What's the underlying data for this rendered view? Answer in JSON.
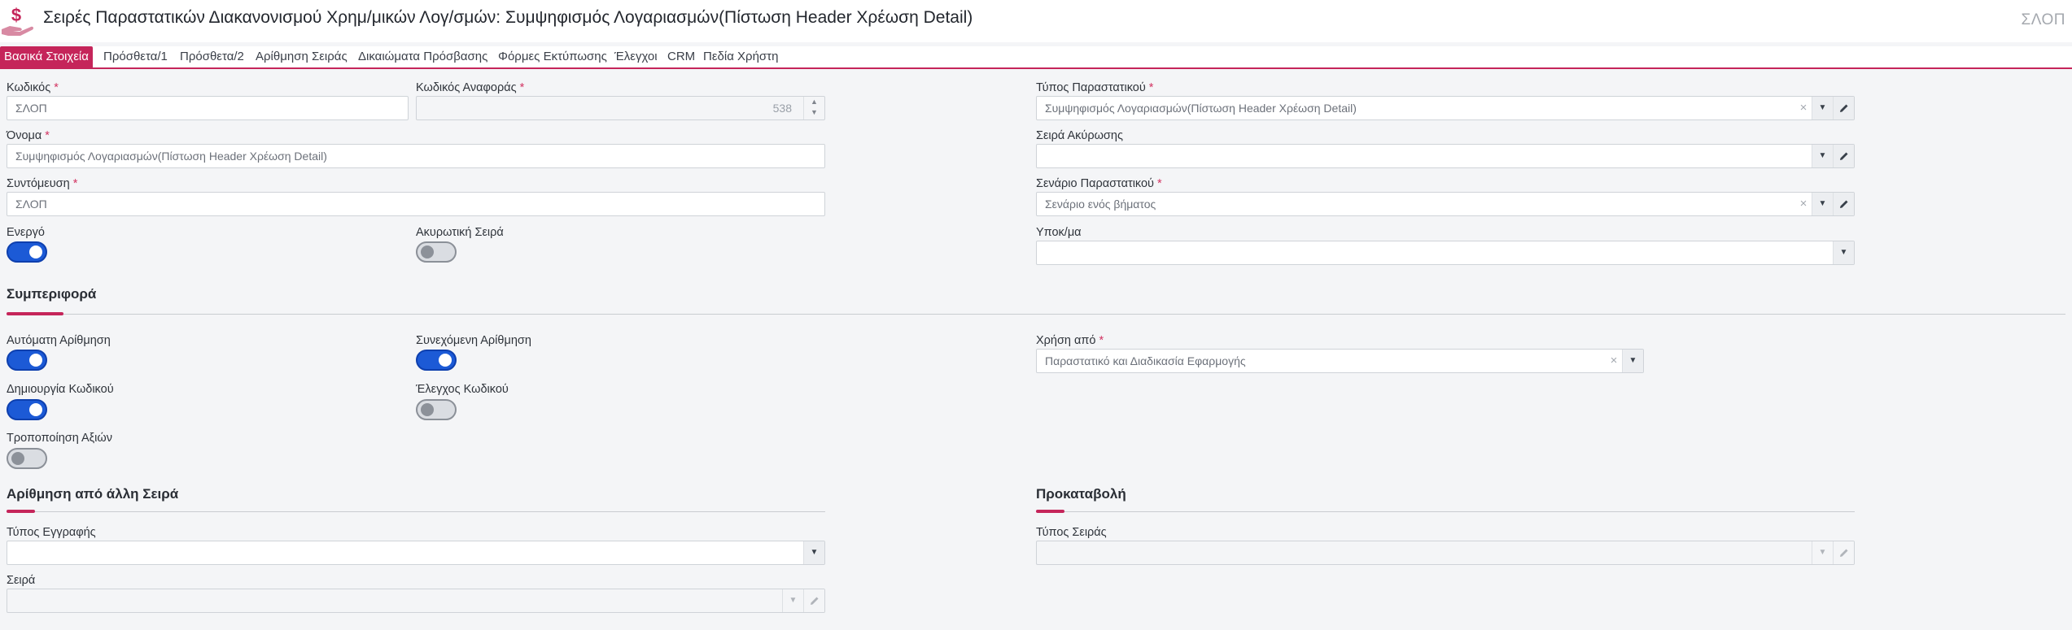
{
  "header": {
    "title": "Σειρές Παραστατικών Διακανονισμού Χρημ/μικών Λογ/σμών: Συμψηφισμός Λογαριασμών(Πίστωση Header Χρέωση Detail)",
    "code": "ΣΛΟΠ",
    "logo_icon": "hand-dollar-icon",
    "accent_color": "#c5255a"
  },
  "tabs": [
    {
      "label": "Βασικά Στοιχεία",
      "active": true
    },
    {
      "label": "Πρόσθετα/1"
    },
    {
      "label": "Πρόσθετα/2"
    },
    {
      "label": "Αρίθμηση Σειράς"
    },
    {
      "label": "Δικαιώματα Πρόσβασης"
    },
    {
      "label": "Φόρμες Εκτύπωσης"
    },
    {
      "label": "Έλεγχοι"
    },
    {
      "label": "CRM"
    },
    {
      "label": "Πεδία Χρήστη"
    }
  ],
  "fields": {
    "kodikos": {
      "label": "Κωδικός",
      "required": "*",
      "value": "ΣΛΟΠ"
    },
    "kodikos_anaforas": {
      "label": "Κωδικός Αναφοράς",
      "required": "*",
      "value": "538"
    },
    "typos_parastatikou": {
      "label": "Τύπος Παραστατικού",
      "required": "*",
      "value": "Συμψηφισμός Λογαριασμών(Πίστωση Header Χρέωση Detail)"
    },
    "onoma": {
      "label": "Όνομα",
      "required": "*",
      "value": "Συμψηφισμός Λογαριασμών(Πίστωση Header Χρέωση Detail)"
    },
    "seira_akyrosis": {
      "label": "Σειρά Ακύρωσης",
      "value": ""
    },
    "syntomeusi": {
      "label": "Συντόμευση",
      "required": "*",
      "value": "ΣΛΟΠ"
    },
    "senario": {
      "label": "Σενάριο Παραστατικού",
      "required": "*",
      "value": "Σενάριο ενός βήματος"
    },
    "energo": {
      "label": "Ενεργό",
      "on": true
    },
    "akyrotiki": {
      "label": "Ακυρωτική Σειρά",
      "on": false
    },
    "ypokatastima": {
      "label": "Υποκ/μα",
      "value": ""
    }
  },
  "behavior": {
    "title": "Συμπεριφορά",
    "auto_numbering": {
      "label": "Αυτόματη Αρίθμηση",
      "on": true
    },
    "continuous_numbering": {
      "label": "Συνεχόμενη Αρίθμηση",
      "on": true
    },
    "usage_from": {
      "label": "Χρήση από",
      "required": "*",
      "value": "Παραστατικό και Διαδικασία Εφαρμογής"
    },
    "create_code": {
      "label": "Δημιουργία Κωδικού",
      "on": true
    },
    "code_check": {
      "label": "Έλεγχος Κωδικού",
      "on": false
    },
    "modify_values": {
      "label": "Τροποποίηση Αξιών",
      "on": false
    }
  },
  "numbering_from_series": {
    "title": "Αρίθμηση από άλλη Σειρά",
    "record_type": {
      "label": "Τύπος Εγγραφής",
      "value": ""
    },
    "series": {
      "label": "Σειρά",
      "value": ""
    }
  },
  "advance": {
    "title": "Προκαταβολή",
    "series_type": {
      "label": "Τύπος Σειράς",
      "value": ""
    }
  },
  "icons": {
    "dropdown": "▼",
    "clear": "×",
    "edit": "pencil-icon",
    "spin_up": "▲",
    "spin_down": "▼"
  }
}
